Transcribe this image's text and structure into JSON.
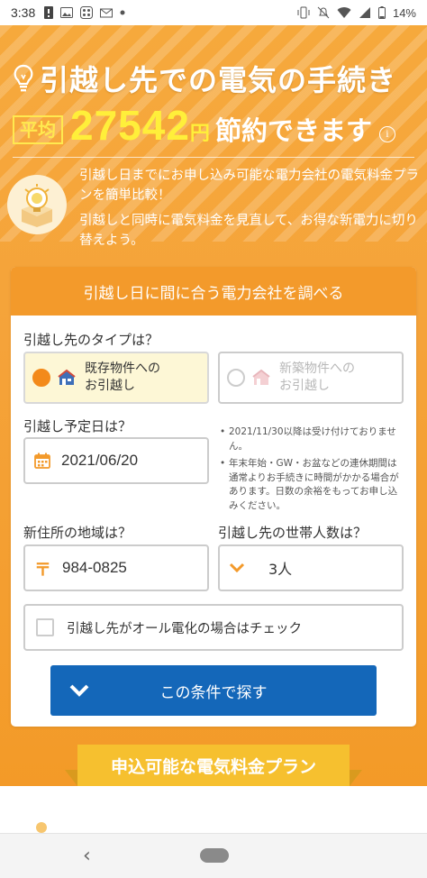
{
  "status_bar": {
    "time": "3:38",
    "battery": "14%"
  },
  "hero": {
    "title": "引越し先での電気の手続き",
    "avg_badge": "平均",
    "amount": "27542",
    "yen": "円",
    "save_text": "節約できます",
    "info": "i",
    "intro_line1": "引越し日までにお申し込み可能な電力会社の電気料金プランを簡単比較！",
    "intro_line2": "引越しと同時に電気料金を見直して、お得な新電力に切り替えよう。"
  },
  "form": {
    "header": "引越し日に間に合う電力会社を調べる",
    "type_label": "引越し先のタイプは？",
    "option_existing_l1": "既存物件への",
    "option_existing_l2": "お引越し",
    "option_new_l1": "新築物件への",
    "option_new_l2": "お引越し",
    "date_label": "引越し予定日は？",
    "date_value": "2021/06/20",
    "note1": "2021/11/30以降は受け付けておりません。",
    "note2": "年末年始・GW・お盆などの連休期間は通常よりお手続きに時間がかかる場合があります。日数の余裕をもってお申し込みください。",
    "region_label": "新住所の地域は？",
    "postal_symbol": "〒",
    "postal_value": "984-0825",
    "household_label": "引越し先の世帯人数は？",
    "household_value": "3人",
    "all_electric_label": "引越し先がオール電化の場合はチェック",
    "search_button": "この条件で探す"
  },
  "banner": {
    "text": "申込可能な電気料金プラン"
  },
  "nav": {
    "back": "‹"
  },
  "colors": {
    "hero_orange": "#f5a33a",
    "accent_orange": "#f39a2b",
    "button_blue": "#1467b9",
    "amount_yellow": "#ffef3a",
    "banner_yellow": "#f6c02f"
  }
}
